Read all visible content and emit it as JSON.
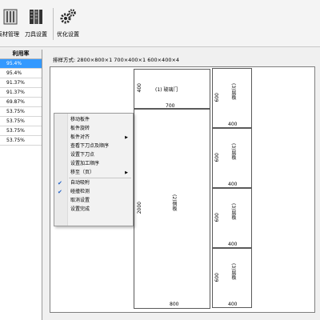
{
  "toolbar": {
    "buttons": [
      {
        "label": "板材管理",
        "icon": "board-manage-icon"
      },
      {
        "label": "刀具设置",
        "icon": "tool-settings-icon"
      },
      {
        "label": "优化设置",
        "icon": "gear-icon"
      }
    ]
  },
  "left_table": {
    "header": "利用率",
    "rows": [
      "95.4%",
      "95.4%",
      "91.37%",
      "91.37%",
      "69.87%",
      "53.75%",
      "53.75%",
      "53.75%",
      "53.75%"
    ]
  },
  "layout_label": "排样方式: 2800×800×1 700×400×1 600×400×4",
  "panels": {
    "door": {
      "name": "(1) 玻璃门",
      "height": "400",
      "width": "700"
    },
    "side": {
      "name": "(2)侧板",
      "height": "2000",
      "width": "800"
    },
    "small": [
      {
        "name": "(3)层板",
        "height": "600",
        "width": "400"
      },
      {
        "name": "(3)层板",
        "height": "600",
        "width": "400"
      },
      {
        "name": "(3)层板",
        "height": "600",
        "width": "400"
      },
      {
        "name": "(3)层板",
        "height": "600",
        "width": "400"
      }
    ]
  },
  "context_menu": {
    "items": [
      {
        "label": "移动板件",
        "checked": false,
        "submenu": false
      },
      {
        "label": "板件旋转",
        "checked": false,
        "submenu": false
      },
      {
        "label": "板件对齐",
        "checked": false,
        "submenu": true
      },
      {
        "label": "查看下刀点及顺序",
        "checked": false,
        "submenu": false
      },
      {
        "label": "设置下刀点",
        "checked": false,
        "submenu": false
      },
      {
        "label": "设置加工顺序",
        "checked": false,
        "submenu": false
      },
      {
        "label": "移至（页）",
        "checked": false,
        "submenu": true
      },
      {
        "label": "自动吸附",
        "checked": true,
        "submenu": false
      },
      {
        "label": "碰撞检测",
        "checked": true,
        "submenu": false
      },
      {
        "label": "取消设置",
        "checked": false,
        "submenu": false
      },
      {
        "label": "设置完成",
        "checked": false,
        "submenu": false
      }
    ]
  }
}
